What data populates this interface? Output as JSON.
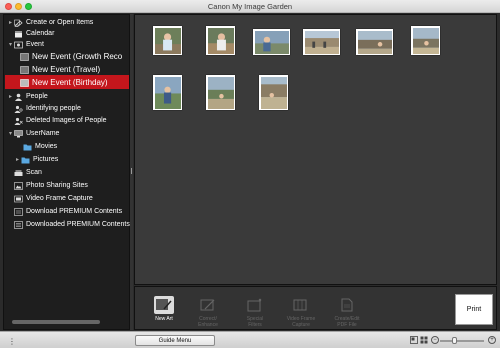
{
  "window": {
    "title": "Canon My Image Garden"
  },
  "sidebar": {
    "items": [
      {
        "label": "Create or Open Items",
        "arrow": "▸"
      },
      {
        "label": "Calendar",
        "arrow": ""
      },
      {
        "label": "Event",
        "arrow": "▾"
      },
      {
        "label": "New Event (Growth Reco",
        "arrow": ""
      },
      {
        "label": "New Event (Travel)",
        "arrow": ""
      },
      {
        "label": "New Event (Birthday)",
        "arrow": ""
      },
      {
        "label": "People",
        "arrow": "▸"
      },
      {
        "label": "Identifying people",
        "arrow": ""
      },
      {
        "label": "Deleted Images of People",
        "arrow": ""
      },
      {
        "label": "UserName",
        "arrow": "▾"
      },
      {
        "label": "Movies",
        "arrow": ""
      },
      {
        "label": "Pictures",
        "arrow": "▸"
      },
      {
        "label": "Scan",
        "arrow": ""
      },
      {
        "label": "Photo Sharing Sites",
        "arrow": ""
      },
      {
        "label": "Video Frame Capture",
        "arrow": ""
      },
      {
        "label": "Download PREMIUM Contents",
        "arrow": ""
      },
      {
        "label": "Downloaded PREMIUM Contents",
        "arrow": ""
      }
    ],
    "selected_item": "New Event (Birthday)"
  },
  "toolbar": {
    "new_art": "New Art",
    "correct_enhance": "Correct/\nEnhance",
    "special_filters": "Special\nFilters",
    "video_frame_capture": "Video Frame\nCapture",
    "create_edit_pdf": "Create/Edit\nPDF File",
    "print": "Print"
  },
  "statusbar": {
    "guide_menu": "Guide Menu"
  },
  "colors": {
    "selection": "#c4161c",
    "background": "#3a3a3a",
    "sidebar": "#1e1e1e"
  }
}
